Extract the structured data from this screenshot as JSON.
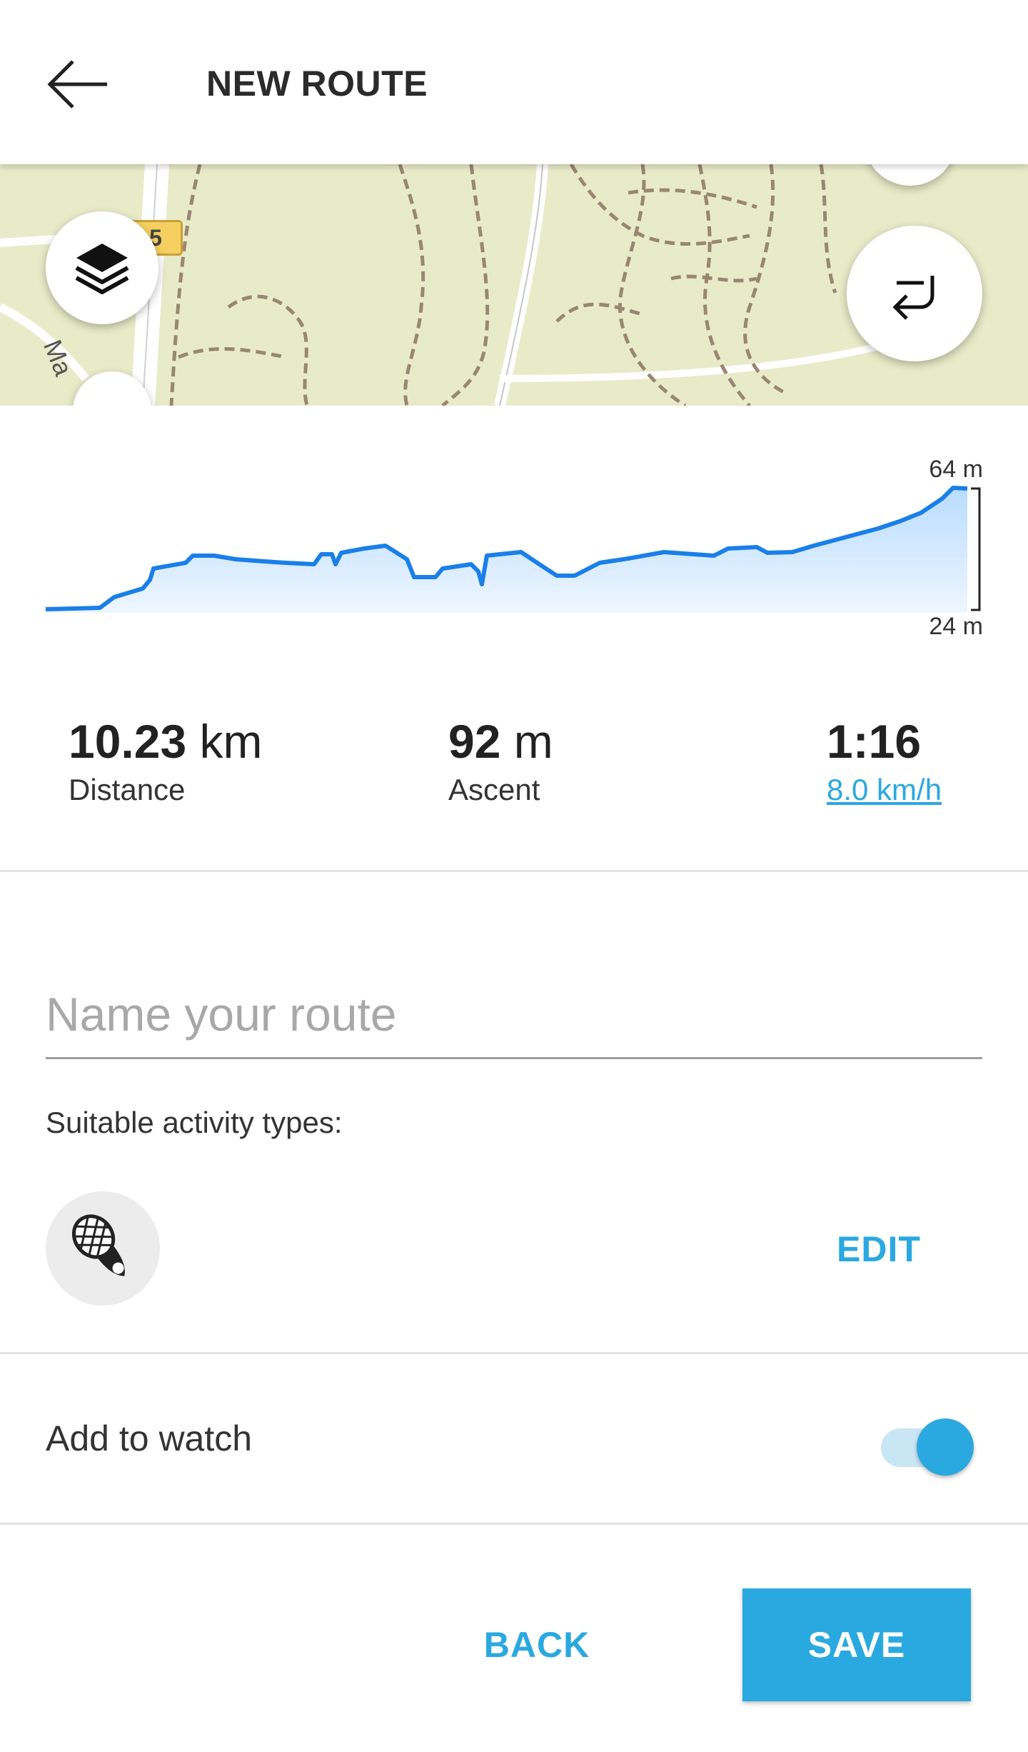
{
  "header": {
    "title": "NEW ROUTE",
    "back_icon": "arrow-left-icon"
  },
  "map": {
    "road_number": "5",
    "street_label": "Ma",
    "layers_icon": "layers-icon",
    "reverse_icon": "reverse-route-icon"
  },
  "elevation": {
    "max_label": "64 m",
    "min_label": "24 m",
    "line_color": "#1a7fe8"
  },
  "stats": {
    "distance": {
      "value": "10.23",
      "unit": " km",
      "label": "Distance"
    },
    "ascent": {
      "value": "92",
      "unit": " m",
      "label": "Ascent"
    },
    "duration": {
      "value": "1:16",
      "speed": "8.0 km/h"
    }
  },
  "form": {
    "name_placeholder": "Name your route",
    "activity_label": "Suitable activity types:",
    "activity_icon": "running-shoe-icon",
    "edit_label": "EDIT",
    "watch_label": "Add to watch",
    "watch_enabled": true
  },
  "actions": {
    "back_label": "BACK",
    "save_label": "SAVE"
  },
  "colors": {
    "accent": "#2aa8e0",
    "map_bg": "#e8ebc8"
  }
}
